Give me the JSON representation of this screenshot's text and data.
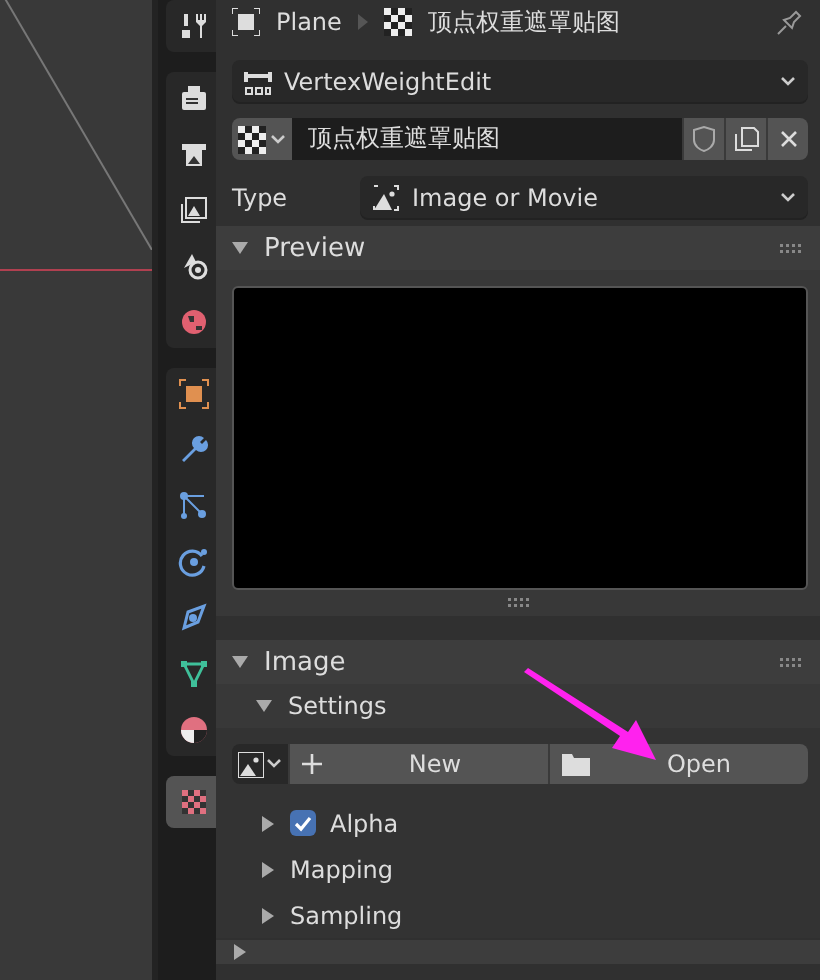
{
  "header": {
    "object": "Plane",
    "texture": "顶点权重遮罩贴图"
  },
  "tab_groups": [
    {
      "tabs": [
        {
          "kind": "tool",
          "selected": false
        }
      ]
    },
    {
      "tabs": [
        {
          "kind": "render",
          "selected": false
        },
        {
          "kind": "output",
          "selected": false
        },
        {
          "kind": "view_layer",
          "selected": false
        },
        {
          "kind": "scene",
          "selected": false
        },
        {
          "kind": "world",
          "selected": false
        }
      ]
    },
    {
      "tabs": [
        {
          "kind": "object",
          "selected": false
        },
        {
          "kind": "modifier",
          "selected": false
        },
        {
          "kind": "particles",
          "selected": false
        },
        {
          "kind": "physics",
          "selected": false
        },
        {
          "kind": "constraints",
          "selected": false
        },
        {
          "kind": "data",
          "selected": false
        },
        {
          "kind": "material",
          "selected": false
        }
      ]
    },
    {
      "tabs": [
        {
          "kind": "texture",
          "selected": true
        }
      ]
    }
  ],
  "modifier_dropdown": {
    "value": "VertexWeightEdit"
  },
  "texture_selector": {
    "value": "顶点权重遮罩贴图"
  },
  "type_field": {
    "label": "Type",
    "value": "Image or Movie"
  },
  "preview": {
    "title": "Preview",
    "expanded": true
  },
  "image_panel": {
    "title": "Image",
    "expanded": true,
    "settings": {
      "title": "Settings",
      "expanded": true
    },
    "buttons": [
      {
        "kind": "new",
        "label": "New"
      },
      {
        "kind": "open",
        "label": "Open"
      }
    ],
    "subpanels": [
      {
        "kind": "check",
        "title": "Alpha",
        "expanded": false,
        "checked": true
      },
      {
        "kind": "plain",
        "title": "Mapping",
        "expanded": false
      },
      {
        "kind": "plain",
        "title": "Sampling",
        "expanded": false
      }
    ]
  },
  "next_panel": {
    "expanded": false
  }
}
